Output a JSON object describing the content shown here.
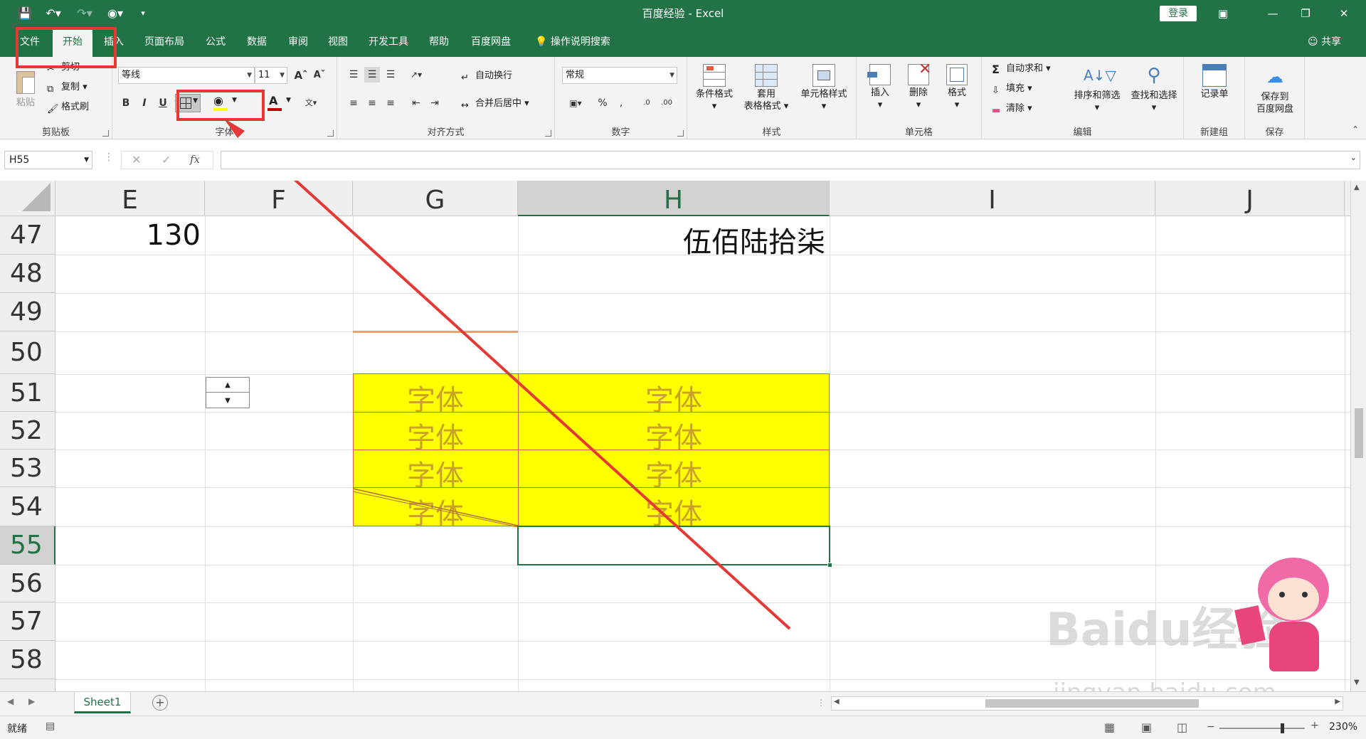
{
  "window": {
    "title": "百度经验  -  Excel",
    "login_label": "登录"
  },
  "tabs": [
    {
      "label": "文件"
    },
    {
      "label": "开始"
    },
    {
      "label": "插入"
    },
    {
      "label": "页面布局"
    },
    {
      "label": "公式"
    },
    {
      "label": "数据"
    },
    {
      "label": "审阅"
    },
    {
      "label": "视图"
    },
    {
      "label": "开发工具"
    },
    {
      "label": "帮助"
    },
    {
      "label": "百度网盘"
    }
  ],
  "tell_me": "操作说明搜索",
  "share": "共享",
  "ribbon": {
    "clipboard": {
      "label": "剪贴板",
      "paste": "粘贴",
      "cut": "剪切",
      "copy": "复制",
      "format_painter": "格式刷"
    },
    "font": {
      "label": "字体",
      "name": "等线",
      "size": "11",
      "bold": "B",
      "italic": "I",
      "underline": "U"
    },
    "alignment": {
      "label": "对齐方式",
      "wrap": "自动换行",
      "merge": "合并后居中"
    },
    "number": {
      "label": "数字",
      "format": "常规"
    },
    "styles": {
      "label": "样式",
      "conditional": "条件格式",
      "table_line1": "套用",
      "table_line2": "表格格式",
      "cell_styles": "单元格样式"
    },
    "cells": {
      "label": "单元格",
      "insert": "插入",
      "delete": "删除",
      "format": "格式"
    },
    "editing": {
      "label": "编辑",
      "autosum": "自动求和",
      "fill": "填充",
      "clear": "清除",
      "sort": "排序和筛选",
      "find": "查找和选择"
    },
    "new_group": {
      "label": "新建组",
      "record": "记录单"
    },
    "save": {
      "label": "保存",
      "line1": "保存到",
      "line2": "百度网盘"
    }
  },
  "formula_bar": {
    "name_box": "H55",
    "fx": "fx",
    "value": ""
  },
  "columns": [
    {
      "letter": "E"
    },
    {
      "letter": "F"
    },
    {
      "letter": "G"
    },
    {
      "letter": "H"
    },
    {
      "letter": "I"
    },
    {
      "letter": "J"
    }
  ],
  "rows": [
    "47",
    "48",
    "49",
    "50",
    "51",
    "52",
    "53",
    "54",
    "55",
    "56",
    "57",
    "58"
  ],
  "cells": {
    "E47": "130",
    "H47": "伍佰陆拾柒",
    "G51": "字体",
    "H51": "字体",
    "G52": "字体",
    "H52": "字体",
    "G53": "字体",
    "H53": "字体",
    "G54": "字体",
    "H54": "字体"
  },
  "sheets": [
    {
      "name": "Sheet1"
    }
  ],
  "status": {
    "ready": "就绪",
    "zoom": "230%"
  },
  "watermark": {
    "brand": "Baidu经验",
    "url": "jingyan.baidu.com"
  },
  "colors": {
    "excel_green": "#217346",
    "highlight_red": "#e53935",
    "fill_yellow": "#ffff00",
    "text_gold": "#c9a227"
  }
}
